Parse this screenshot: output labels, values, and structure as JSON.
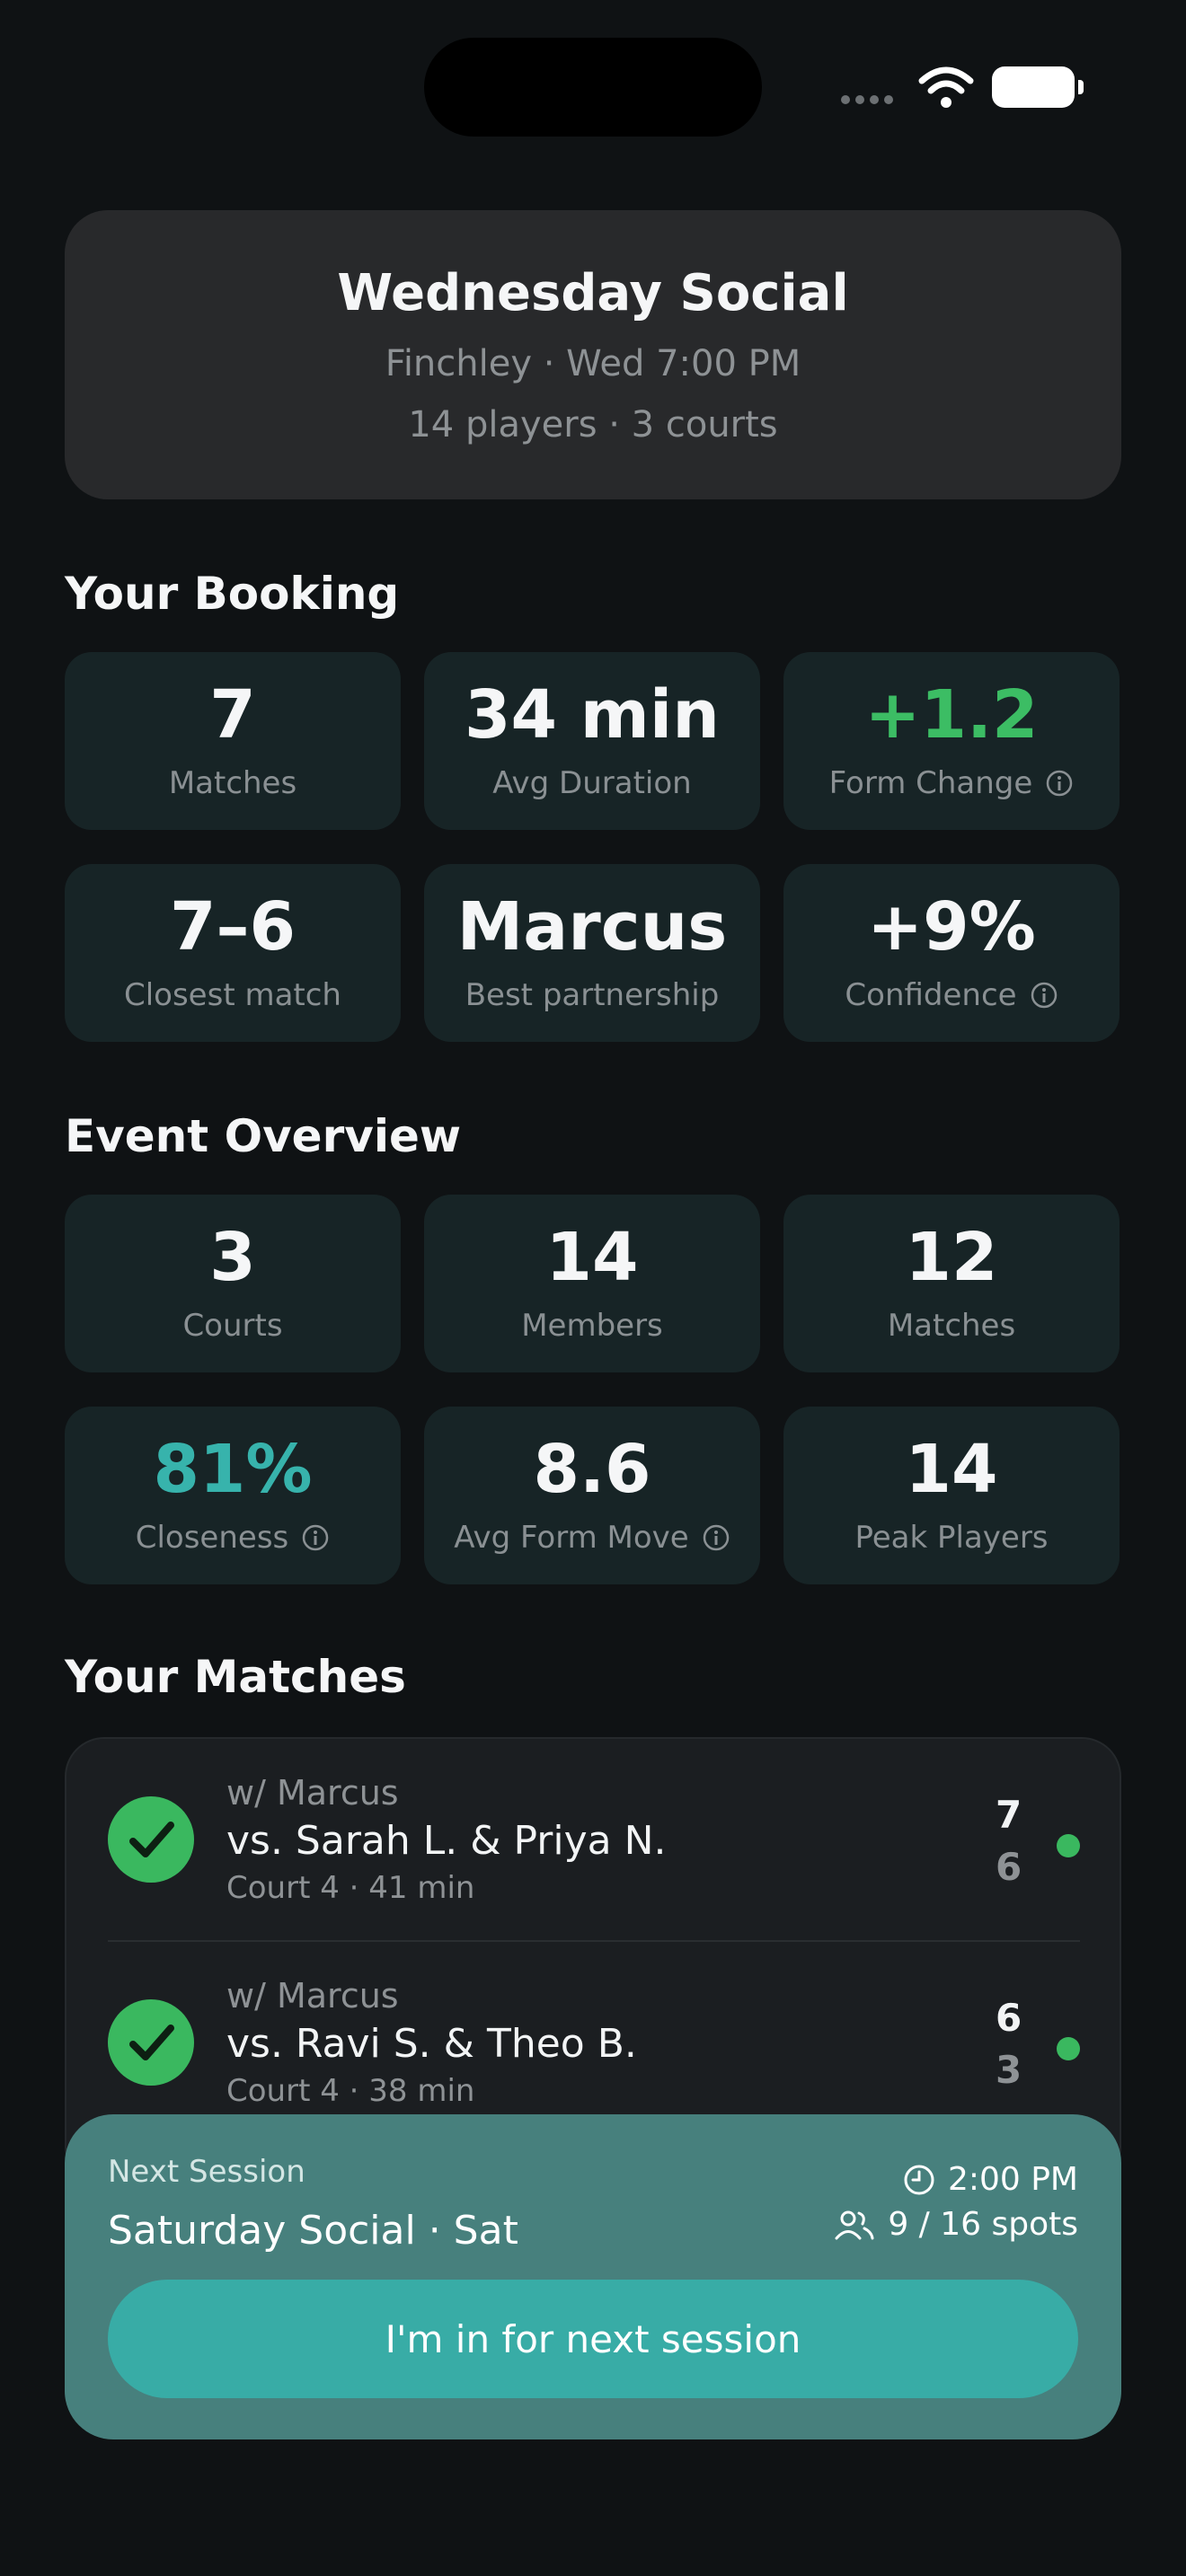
{
  "event": {
    "title": "Wednesday Social",
    "location_time": "Finchley · Wed 7:00 PM",
    "summary": "14 players · 3 courts"
  },
  "booking": {
    "section_title": "Your Booking",
    "tiles": [
      {
        "value": "7",
        "label": "Matches"
      },
      {
        "value": "34 min",
        "label": "Avg Duration"
      },
      {
        "value": "+1.2",
        "label": "Form Change"
      },
      {
        "value": "7–6",
        "label": "Closest match"
      },
      {
        "value": "Marcus",
        "label": "Best partnership"
      },
      {
        "value": "+9%",
        "label": "Confidence"
      }
    ]
  },
  "overview": {
    "section_title": "Event Overview",
    "tiles": [
      {
        "value": "3",
        "label": "Courts"
      },
      {
        "value": "14",
        "label": "Members"
      },
      {
        "value": "12",
        "label": "Matches"
      },
      {
        "value": "81%",
        "label": "Closeness"
      },
      {
        "value": "8.6",
        "label": "Avg Form Move"
      },
      {
        "value": "14",
        "label": "Peak Players"
      }
    ]
  },
  "matches": {
    "section_title": "Your Matches",
    "items": [
      {
        "partner": "w/ Marcus",
        "opponents": "vs. Sarah L. & Priya N.",
        "meta": "Court 4 · 41 min",
        "score_us": "7",
        "score_them": "6"
      },
      {
        "partner": "w/ Marcus",
        "opponents": "vs. Ravi S. & Theo B.",
        "meta": "Court 4 · 38 min",
        "score_us": "6",
        "score_them": "3"
      }
    ]
  },
  "next_session": {
    "label": "Next Session",
    "title": "Saturday Social · Sat",
    "time": "2:00 PM",
    "spots": "9 / 16 spots",
    "cta": "I'm in for next session"
  },
  "colors": {
    "background": "#0f1214",
    "tile": "#172426",
    "positive": "#3cbd64",
    "accent": "#37b3ac",
    "next_card": "#47807d"
  }
}
